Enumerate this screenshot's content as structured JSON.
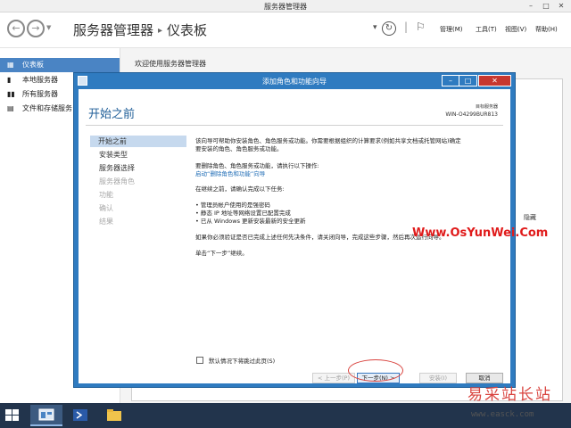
{
  "window": {
    "title": "服务器管理器",
    "controls": [
      "–",
      "□",
      "✕"
    ]
  },
  "header": {
    "breadcrumb_root": "服务器管理器",
    "breadcrumb_sep": "▸",
    "breadcrumb_current": "仪表板",
    "menu": [
      "管理(M)",
      "工具(T)",
      "视图(V)",
      "帮助(H)"
    ]
  },
  "sidebar": {
    "items": [
      {
        "label": "仪表板",
        "icon": "dashboard-icon",
        "active": true
      },
      {
        "label": "本地服务器",
        "icon": "server-icon",
        "active": false
      },
      {
        "label": "所有服务器",
        "icon": "servers-icon",
        "active": false
      },
      {
        "label": "文件和存储服务",
        "icon": "storage-icon",
        "active": false
      }
    ]
  },
  "main": {
    "welcome_title": "欢迎使用服务器管理器",
    "bg_label_right": "隐藏"
  },
  "wizard": {
    "title": "添加角色和功能向导",
    "heading": "开始之前",
    "server_label": "目标服务器",
    "server_name": "WIN-O4299BUR813",
    "steps": [
      {
        "label": "开始之前",
        "state": "active"
      },
      {
        "label": "安装类型",
        "state": "normal"
      },
      {
        "label": "服务器选择",
        "state": "normal"
      },
      {
        "label": "服务器角色",
        "state": "disabled"
      },
      {
        "label": "功能",
        "state": "disabled"
      },
      {
        "label": "确认",
        "state": "disabled"
      },
      {
        "label": "结果",
        "state": "disabled"
      }
    ],
    "intro_line1": "该向导可帮助你安装角色、角色服务或功能。你需要根据组织的计算要求(例如共享文档或托管网站)确定",
    "intro_line2": "要安装的角色、角色服务或功能。",
    "remove_line": "要删除角色、角色服务或功能，请执行以下操作:",
    "remove_link": "启动“删除角色和功能”向导",
    "tasks_intro": "在继续之前，请确认完成以下任务:",
    "tasks": [
      "• 管理员帐户使用的是强密码",
      "• 静态 IP 地址等网络设置已配置完成",
      "• 已从 Windows 更新安装最新的安全更新"
    ],
    "verify_line": "如果你必须验证是否已完成上述任何先决条件，请关闭向导，完成这些步骤，然后再次运行向导。",
    "next_hint": "单击“下一步”继续。",
    "watermark_site": "Www.OsYunWei.Com",
    "skip_label": "默认情况下将跳过此页(S)",
    "buttons": {
      "prev": "< 上一步(P)",
      "next": "下一步(N) >",
      "install": "安装(I)",
      "cancel": "取消"
    }
  },
  "taskbar": {
    "items": [
      "server-manager-icon",
      "powershell-icon",
      "file-explorer-icon"
    ]
  },
  "logo": {
    "name": "易采站长站",
    "url": "www.easck.com"
  }
}
